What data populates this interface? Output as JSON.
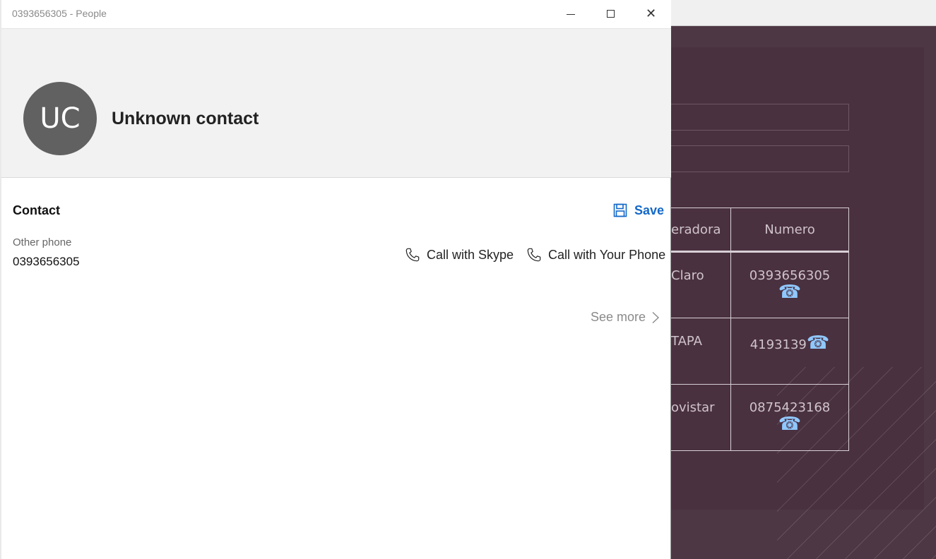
{
  "window": {
    "title": "0393656305 - People",
    "close_glyph": "✕"
  },
  "header": {
    "avatar_initials": "UC",
    "contact_name": "Unknown contact"
  },
  "contact": {
    "section_title": "Contact",
    "save_label": "Save",
    "phone_label": "Other phone",
    "phone_value": "0393656305",
    "call_skype_label": "Call with Skype",
    "call_yourphone_label": "Call with Your Phone",
    "see_more_label": "See more"
  },
  "background_app": {
    "url_chevron": "⌄",
    "table": {
      "headers": [
        "eradora",
        "Numero"
      ],
      "rows": [
        {
          "operator": "Claro",
          "number": "0393656305"
        },
        {
          "operator": "TAPA",
          "number": "4193139"
        },
        {
          "operator": "ovistar",
          "number": "0875423168"
        }
      ],
      "phone_icon": "☎"
    }
  },
  "colors": {
    "accent": "#1468c8",
    "avatar_bg": "#616161",
    "header_bg": "#f2f2f2",
    "bg_app": "#4e3744"
  },
  "icons": [
    "minimize-icon",
    "maximize-icon",
    "close-icon",
    "save-icon",
    "phone-icon",
    "chevron-right-icon",
    "play-icon"
  ]
}
